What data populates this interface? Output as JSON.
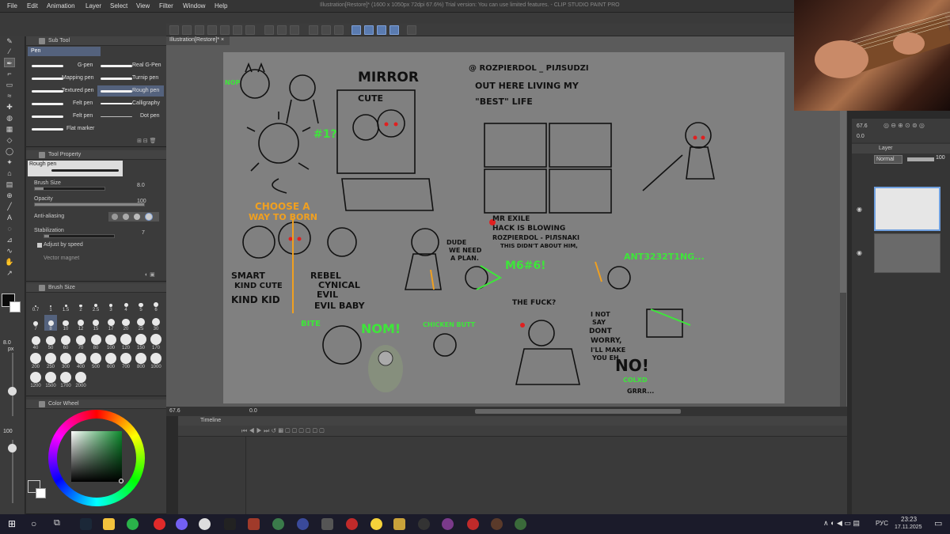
{
  "menubar": {
    "items": [
      "File",
      "Edit",
      "Animation",
      "Layer",
      "Select",
      "View",
      "Filter",
      "Window",
      "Help"
    ],
    "title": "Illustration[Restore]* (1600 x 1050px 72dpi 67.6%)  Trial version: You can use limited features. - CLIP STUDIO PAINT PRO"
  },
  "document": {
    "tab_label": "Illustration[Restore]*"
  },
  "subtool": {
    "title": "Sub Tool",
    "tab": "Pen",
    "brushes": [
      "G-pen",
      "Real G-Pen",
      "Mapping pen",
      "Turnip pen",
      "Textured pen",
      "Rough pen",
      "Felt pen",
      "Calligraphy",
      "Felt pen",
      "Dot pen",
      "Flat marker"
    ]
  },
  "toolproperty": {
    "title": "Tool Property",
    "brush_name": "Rough pen",
    "brush_size_label": "Brush Size",
    "brush_size_value": "8.0",
    "opacity_label": "Opacity",
    "opacity_value": "100",
    "antialias_label": "Anti-aliasing",
    "stabilization_label": "Stabilization",
    "stabilization_value": "7",
    "adjust_speed_label": "Adjust by speed",
    "vector_magnet_label": "Vector magnet"
  },
  "brushsize": {
    "title": "Brush Size",
    "sizes": [
      "0.7",
      "1",
      "1.5",
      "2",
      "2.5",
      "3",
      "4",
      "5",
      "6",
      "7",
      "8",
      "10",
      "12",
      "15",
      "17",
      "20",
      "25",
      "30",
      "40",
      "50",
      "60",
      "70",
      "80",
      "100",
      "120",
      "150",
      "170",
      "200",
      "250",
      "300",
      "400",
      "500",
      "600",
      "700",
      "800",
      "1000",
      "1200",
      "1500",
      "1700",
      "2000"
    ],
    "current_size": "8.0",
    "current_unit": "px",
    "opacity_pct": "100"
  },
  "colorwheel": {
    "title": "Color Wheel",
    "main_color": "#0a0a0a",
    "sub_color": "#ffffff"
  },
  "navigator": {
    "zoom": "67.6",
    "rotation": "0.0"
  },
  "status": {
    "zoom": "67.6",
    "rotation": "0.0"
  },
  "timeline": {
    "title": "Timeline"
  },
  "layer": {
    "title": "Layer",
    "blend": "Normal",
    "opacity": "100"
  },
  "sketch_text": {
    "mirror": "MIRROR",
    "cute": "CUTE",
    "handle_line1": "@ ROZPIERDOL _ PIЛSUDZI",
    "handle_line2": "OUT HERE LIVING MY",
    "handle_line3": "\"BEST\" LIFE",
    "mr_exile1": "MR EXILE",
    "mr_exile2": "HACK  IS BLOWING",
    "mr_exile3": "ROZPIERDOL - PIЛSNAKI",
    "mr_exile4": "THIS DIDN'T ABOUT HIM,",
    "choose": "CHOOSE A",
    "choose2": "WAY TO BORN",
    "smart": "SMART",
    "kind_cute": "KIND CUTE",
    "kind_kid": "KIND KID",
    "rebel": "REBEL",
    "cynical": "CYNICAL",
    "evil": "EVIL",
    "evil_baby": "EVIL BABY",
    "dude": "DUDE",
    "we_need": "WE NEED",
    "a_plan": "A PLAN.",
    "meme": "M6#6!",
    "ant": "ANT3232T1NG...",
    "the_fuck": "THE FUCK?",
    "i_not": "I NOT",
    "say": "SAY",
    "dont": "DONT",
    "worry": "WORRY,",
    "ill_make": "I'LL MAKE",
    "you_eh": "YOU EH",
    "no": "NO!",
    "colxd": "COLXD",
    "grrr": "GRRR...",
    "nom": "NOM!",
    "bite": "BITE",
    "chicken": "CHICKEN BUTT",
    "num": "#1?",
    "nop": "NOP"
  },
  "taskbar": {
    "lang": "РУС",
    "time": "23:23",
    "date": "17.11.2025"
  },
  "colors": {
    "sketch_green": "#3ee63a",
    "sketch_orange": "#f0a020",
    "sketch_red": "#e02020"
  }
}
